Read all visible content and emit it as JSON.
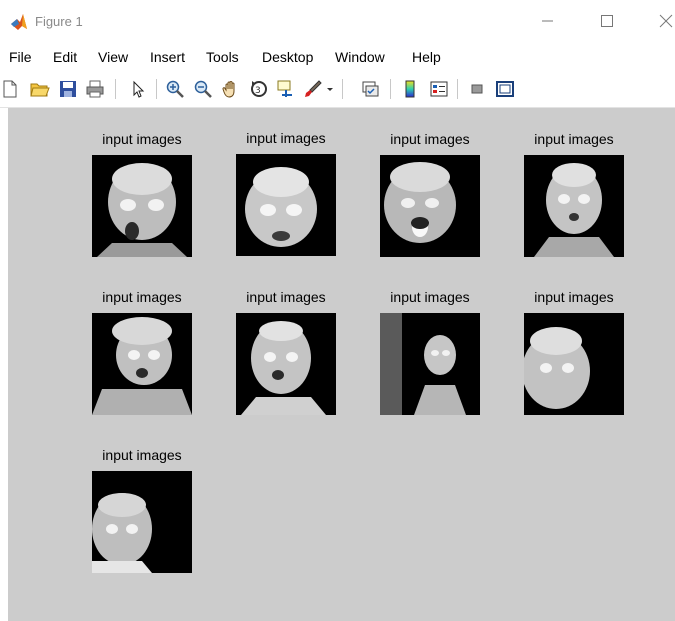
{
  "window": {
    "title": "Figure 1"
  },
  "menu": [
    "File",
    "Edit",
    "View",
    "Insert",
    "Tools",
    "Desktop",
    "Window",
    "Help"
  ],
  "toolbar": [
    "new-figure-icon",
    "open-file-icon",
    "save-icon",
    "print-icon",
    "pointer-icon",
    "zoom-in-icon",
    "zoom-out-icon",
    "pan-hand-icon",
    "rotate-3d-icon",
    "data-cursor-icon",
    "brush-icon",
    "brush-dropdown-icon",
    "link-plot-icon",
    "colorbar-icon",
    "legend-icon",
    "hide-plot-tools-icon",
    "show-plot-tools-icon"
  ],
  "subplots": [
    {
      "title": "input images"
    },
    {
      "title": "input images"
    },
    {
      "title": "input images"
    },
    {
      "title": "input images"
    },
    {
      "title": "input images"
    },
    {
      "title": "input images"
    },
    {
      "title": "input images"
    },
    {
      "title": "input images"
    },
    {
      "title": "input images"
    }
  ],
  "colors": {
    "figure_bg": "#cccccc",
    "axes_bg": "#000000"
  }
}
